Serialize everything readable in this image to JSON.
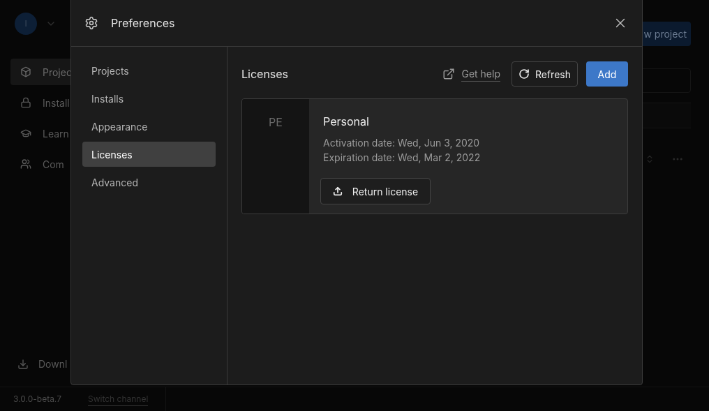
{
  "background": {
    "avatar": "I",
    "nav": [
      {
        "label": "Projec",
        "selected": true
      },
      {
        "label": "Install",
        "selected": false
      },
      {
        "label": "Learn",
        "selected": false
      },
      {
        "label": "Com",
        "selected": false
      }
    ],
    "download": "Downl",
    "new_project": "w project",
    "version": "3.0.0-beta.7",
    "switch_channel": "Switch channel"
  },
  "dialog": {
    "title": "Preferences",
    "nav": [
      {
        "label": "Projects",
        "selected": false
      },
      {
        "label": "Installs",
        "selected": false
      },
      {
        "label": "Appearance",
        "selected": false
      },
      {
        "label": "Licenses",
        "selected": true
      },
      {
        "label": "Advanced",
        "selected": false
      }
    ],
    "heading": "Licenses",
    "get_help": "Get help",
    "refresh": "Refresh",
    "add": "Add",
    "licenses": [
      {
        "badge": "PE",
        "name": "Personal",
        "activation": "Activation date: Wed, Jun 3, 2020",
        "expiration": "Expiration date: Wed, Mar 2, 2022",
        "action": "Return license"
      }
    ]
  }
}
